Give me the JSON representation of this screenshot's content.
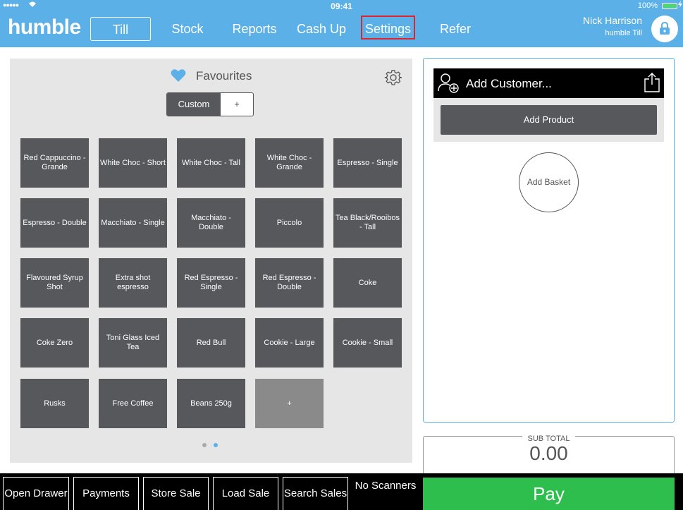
{
  "status": {
    "signal": "●●●●●",
    "time": "09:41",
    "battery": "100%"
  },
  "nav": {
    "brand": "humble",
    "items": [
      {
        "label": "Till"
      },
      {
        "label": "Stock"
      },
      {
        "label": "Reports"
      },
      {
        "label": "Cash Up"
      },
      {
        "label": "Settings"
      },
      {
        "label": "Refer"
      }
    ],
    "user_name": "Nick Harrison",
    "till_name": "humble Till"
  },
  "favourites": {
    "title": "Favourites",
    "segment_custom": "Custom",
    "segment_add": "+",
    "tiles": [
      "Red Cappuccino - Grande",
      "White Choc - Short",
      "White Choc - Tall",
      "White Choc - Grande",
      "Espresso - Single",
      "Espresso - Double",
      "Macchiato - Single",
      "Macchiato - Double",
      "Piccolo",
      "Tea Black/Rooibos - Tall",
      "Flavoured Syrup Shot",
      "Extra shot espresso",
      "Red Espresso - Single",
      "Red Espresso - Double",
      "Coke",
      "Coke Zero",
      "Toni Glass Iced Tea",
      "Red Bull",
      "Cookie - Large",
      "Cookie - Small",
      "Rusks",
      "Free Coffee",
      "Beans 250g",
      "+"
    ]
  },
  "basket": {
    "add_customer": "Add Customer...",
    "add_product": "Add Product",
    "add_basket": "Add Basket"
  },
  "subtotal": {
    "label": "SUB TOTAL",
    "value": "0.00"
  },
  "bottom": {
    "open_drawer": "Open Drawer",
    "payments": "Payments",
    "store_sale": "Store Sale",
    "load_sale": "Load Sale",
    "search_sales": "Search Sales",
    "no_scanners": "No Scanners",
    "pay": "Pay"
  },
  "colors": {
    "accent": "#5bb0e8",
    "tile": "#57585c",
    "pay": "#2dbe4e",
    "highlight": "#e0242b"
  }
}
